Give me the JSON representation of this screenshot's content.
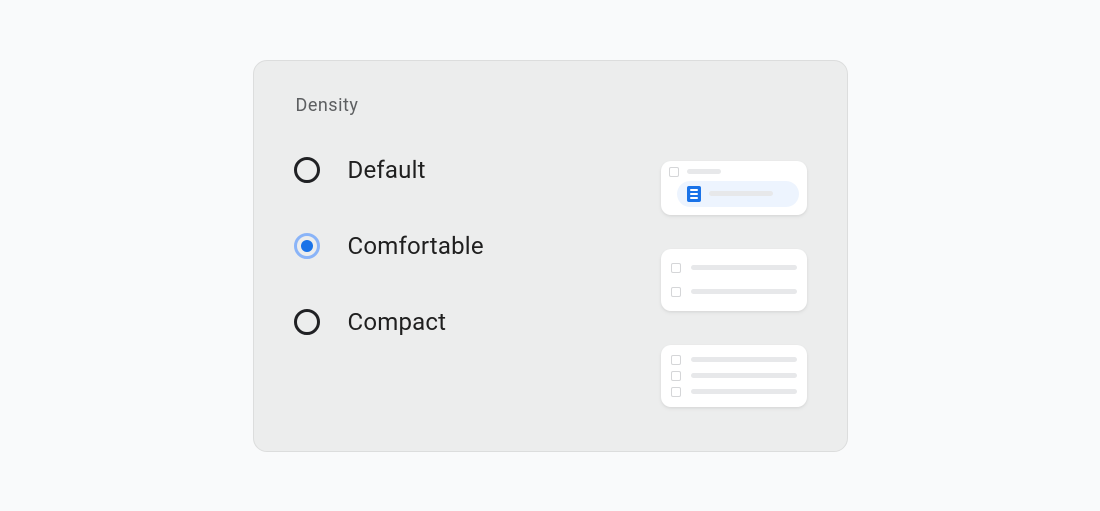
{
  "card": {
    "title": "Density",
    "selected": "comfortable",
    "options": [
      {
        "id": "default",
        "label": "Default"
      },
      {
        "id": "comfortable",
        "label": "Comfortable"
      },
      {
        "id": "compact",
        "label": "Compact"
      }
    ]
  },
  "colors": {
    "card_bg": "#eceded",
    "card_border": "#dcdddd",
    "accent": "#1a73e8",
    "accent_ring": "#8ab4f8",
    "text": "#1f1f1f",
    "muted": "#5d5f61"
  }
}
